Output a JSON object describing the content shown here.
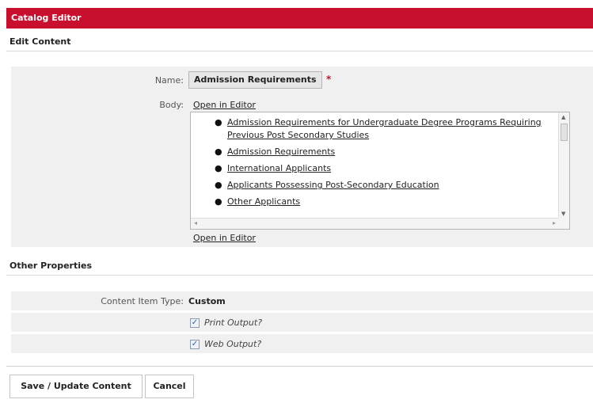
{
  "window": {
    "title": "Catalog Editor"
  },
  "edit_content": {
    "heading": "Edit Content",
    "name_label": "Name:",
    "name_value": "Admission Requirements",
    "required_mark": "*",
    "body_label": "Body:",
    "open_in_editor": "Open in Editor",
    "body_links": [
      "Admission Requirements for Undergraduate Degree Programs Requiring Previous Post Secondary Studies",
      "Admission Requirements",
      "International Applicants",
      "Applicants Possessing Post-Secondary Education",
      "Other Applicants"
    ]
  },
  "other_properties": {
    "heading": "Other Properties",
    "content_item_type_label": "Content Item Type:",
    "content_item_type_value": "Custom",
    "print_output": {
      "label": "Print Output?",
      "checked": true
    },
    "web_output": {
      "label": "Web Output?",
      "checked": true
    }
  },
  "actions": {
    "save_label": "Save / Update Content",
    "cancel_label": "Cancel"
  },
  "colors": {
    "accent": "#c8102e",
    "panel": "#f0f0f0"
  },
  "icons": {
    "bullet": "bullet-icon",
    "checkbox": "check-icon"
  }
}
